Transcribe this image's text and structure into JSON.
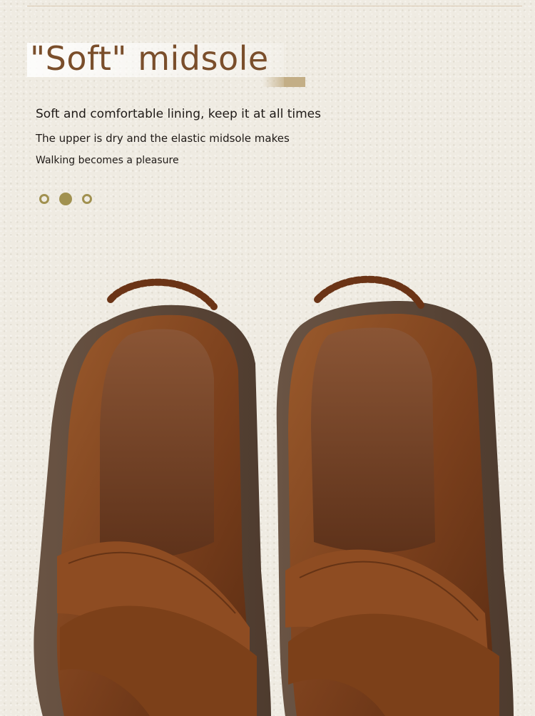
{
  "header": {
    "title": "\"Soft\" midsole",
    "lines": [
      "Soft and comfortable lining, keep it at all times",
      "The upper is dry and the elastic midsole makes",
      "Walking becomes a pleasure"
    ]
  },
  "carousel": {
    "dots": 3,
    "active_index": 1
  },
  "photo": {
    "subject": "brown leather sandals",
    "colors": {
      "leather": "#8a4a22",
      "leather_dark": "#5e2f14",
      "insole": "#6e3c1e",
      "sole": "#5e4736"
    }
  }
}
